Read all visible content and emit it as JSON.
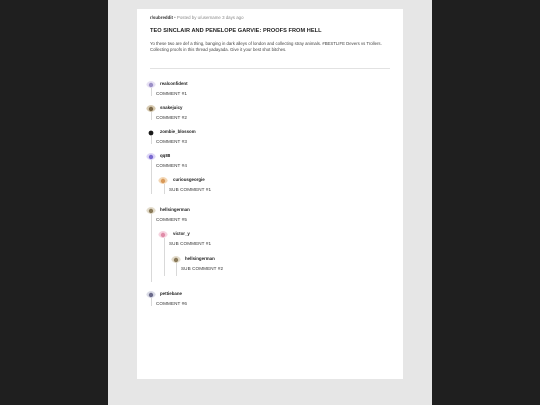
{
  "post": {
    "subreddit": "r/subreddit",
    "posted_by": " • Posted by u/username 3 days ago",
    "title": "TEO SINCLAIR AND PENELOPE GARVIE: PROOFS FROM HELL",
    "body": "Yo these two are def a thing, banging in dark alleys of london and collecting stray animals. #BESTLIFE Devers vs Trollers. Collecting proofs in this thread yadayada. Give it your best shot bitches."
  },
  "comments": [
    {
      "username": "realconfident",
      "text": "COMMENT #1",
      "avatar_icon": "portrait-icon",
      "avatar_color": "#9b8fc7"
    },
    {
      "username": "snakejuicy",
      "text": "COMMENT #2",
      "avatar_icon": "portrait-icon",
      "avatar_color": "#7d6a4a"
    },
    {
      "username": "zombie_blossom",
      "text": "COMMENT #3",
      "avatar_icon": "portrait-icon",
      "avatar_color": "#1a1a1a"
    },
    {
      "username": "qq88",
      "text": "COMMENT #4",
      "avatar_icon": "portrait-icon",
      "avatar_color": "#7a6ad0"
    },
    {
      "username": "curiousgeorgie",
      "text": "SUB COMMENT #1",
      "avatar_icon": "portrait-icon",
      "avatar_color": "#d99a5a"
    },
    {
      "username": "hellsingerman",
      "text": "COMMENT #5",
      "avatar_icon": "portrait-icon",
      "avatar_color": "#8a7a5a"
    },
    {
      "username": "victor_y",
      "text": "SUB COMMENT #1",
      "avatar_icon": "portrait-icon",
      "avatar_color": "#e08ca8"
    },
    {
      "username": "hellsingerman",
      "text": "SUB COMMENT #2",
      "avatar_icon": "portrait-icon",
      "avatar_color": "#8a7a5a"
    },
    {
      "username": "pettiebane",
      "text": "COMMENT #6",
      "avatar_icon": "portrait-icon",
      "avatar_color": "#6a6a8a"
    }
  ]
}
